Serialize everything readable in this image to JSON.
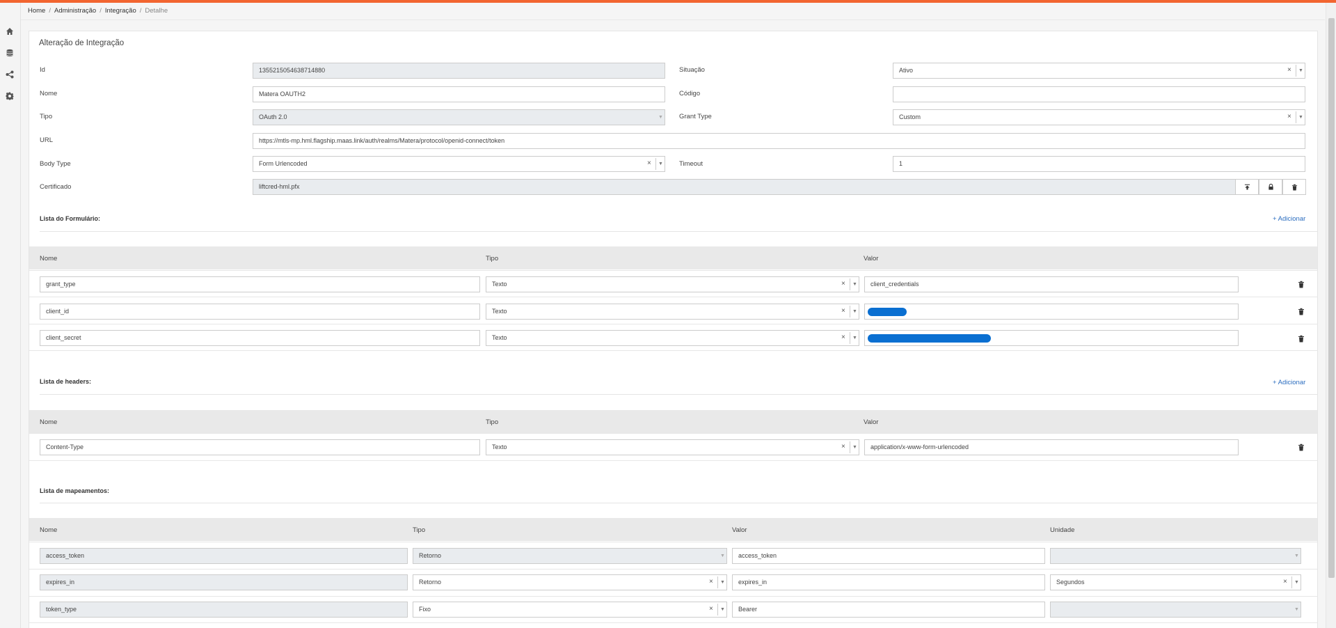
{
  "breadcrumb": [
    "Home",
    "Administração",
    "Integração",
    "Detalhe"
  ],
  "sidebar": [
    {
      "icon": "home-icon"
    },
    {
      "icon": "database-icon"
    },
    {
      "icon": "share-icon"
    },
    {
      "icon": "gear-icon"
    }
  ],
  "title": "Alteração de Integração",
  "form": {
    "id_label": "Id",
    "id_value": "1355215054638714880",
    "situacao_label": "Situação",
    "situacao_value": "Ativo",
    "nome_label": "Nome",
    "nome_value": "Matera OAUTH2",
    "codigo_label": "Código",
    "codigo_value": "",
    "tipo_label": "Tipo",
    "tipo_value": "OAuth 2.0",
    "grant_label": "Grant Type",
    "grant_value": "Custom",
    "url_label": "URL",
    "url_value": "https://mtls-mp.hml.flagship.maas.link/auth/realms/Matera/protocol/openid-connect/token",
    "body_label": "Body Type",
    "body_value": "Form Urlencoded",
    "timeout_label": "Timeout",
    "timeout_value": "1",
    "cert_label": "Certificado",
    "cert_value": "liftcred-hml.pfx"
  },
  "formulario": {
    "title": "Lista do Formulário:",
    "add": "+ Adicionar",
    "columns": [
      "Nome",
      "Tipo",
      "Valor"
    ],
    "rows": [
      {
        "nome": "grant_type",
        "tipo": "Texto",
        "valor": "client_credentials"
      },
      {
        "nome": "client_id",
        "tipo": "Texto",
        "valor": ""
      },
      {
        "nome": "client_secret",
        "tipo": "Texto",
        "valor": ""
      }
    ]
  },
  "headers": {
    "title": "Lista de headers:",
    "add": "+ Adicionar",
    "columns": [
      "Nome",
      "Tipo",
      "Valor"
    ],
    "rows": [
      {
        "nome": "Content-Type",
        "tipo": "Texto",
        "valor": "application/x-www-form-urlencoded"
      }
    ]
  },
  "mapeamentos": {
    "title": "Lista de mapeamentos:",
    "columns": [
      "Nome",
      "Tipo",
      "Valor",
      "Unidade"
    ],
    "rows": [
      {
        "nome": "access_token",
        "tipo": "Retorno",
        "valor": "access_token",
        "unidade": ""
      },
      {
        "nome": "expires_in",
        "tipo": "Retorno",
        "valor": "expires_in",
        "unidade": "Segundos"
      },
      {
        "nome": "token_type",
        "tipo": "Fixo",
        "valor": "Bearer",
        "unidade": ""
      }
    ]
  },
  "colors": {
    "accent": "#f26530",
    "link": "#2a6cbf",
    "redaction": "#0a6fd1"
  }
}
